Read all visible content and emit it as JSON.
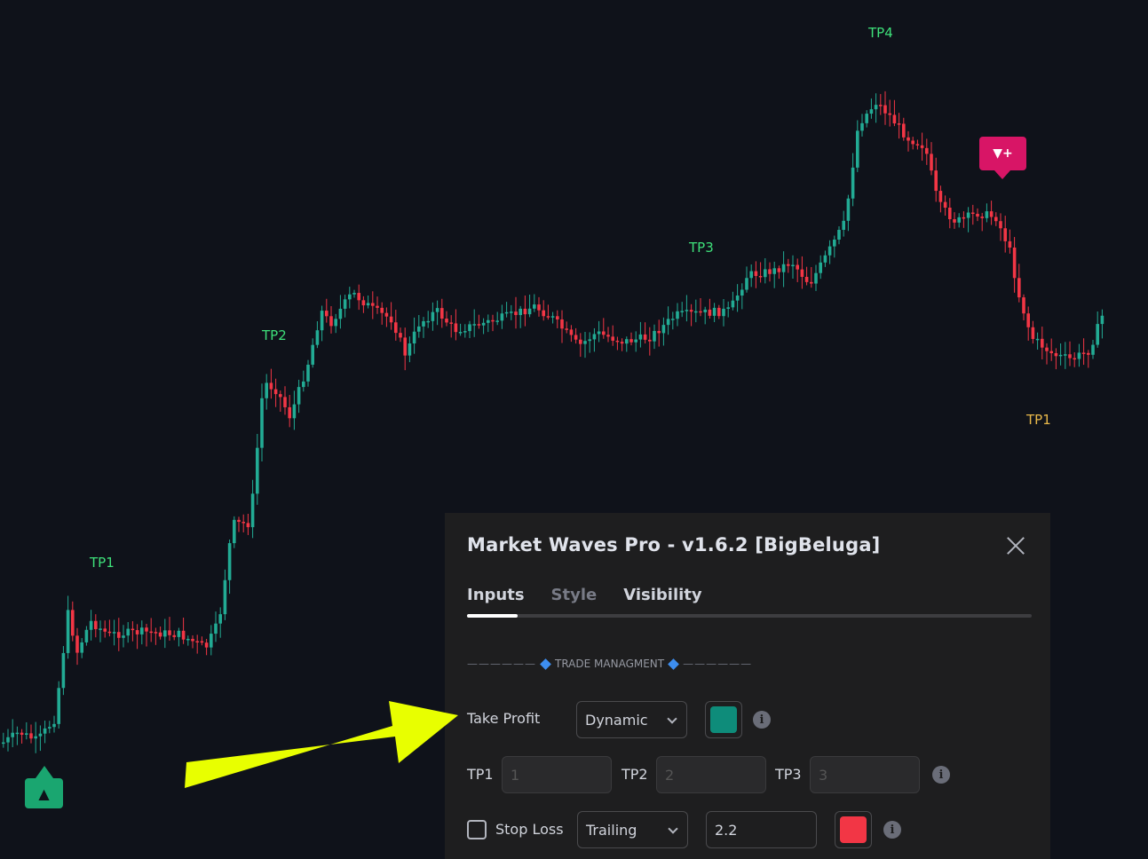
{
  "chart": {
    "tp_labels": [
      {
        "text": "TP1",
        "style": "green"
      },
      {
        "text": "TP2",
        "style": "green"
      },
      {
        "text": "TP3",
        "style": "green"
      },
      {
        "text": "TP4",
        "style": "green"
      },
      {
        "text": "TP1",
        "style": "gold"
      }
    ],
    "buy_marker_icon": "▲",
    "sell_marker_icon": "▼+",
    "colors": {
      "bull": "#22ab94",
      "bear": "#f23645",
      "background": "#0f121a",
      "tp_green": "#3ee07a",
      "tp_gold": "#e8b84a"
    }
  },
  "dialog": {
    "title": "Market Waves Pro - v1.6.2 [BigBeluga]",
    "tabs": [
      {
        "label": "Inputs",
        "active": true
      },
      {
        "label": "Style",
        "active": false
      },
      {
        "label": "Visibility",
        "active": false
      }
    ],
    "section": {
      "dashes_left": "——————",
      "title": "TRADE MANAGMENT",
      "dashes_right": "——————"
    },
    "take_profit": {
      "label": "Take Profit",
      "mode": "Dynamic",
      "color": "#0e8c7a"
    },
    "tp_inputs": [
      {
        "label": "TP1",
        "placeholder": "1"
      },
      {
        "label": "TP2",
        "placeholder": "2"
      },
      {
        "label": "TP3",
        "placeholder": "3"
      }
    ],
    "stop_loss": {
      "label": "Stop Loss",
      "checked": false,
      "mode": "Trailing",
      "value": "2.2",
      "color": "#f23645"
    },
    "info_glyph": "i"
  },
  "annotation": {
    "arrow_color": "#e8ff00"
  }
}
